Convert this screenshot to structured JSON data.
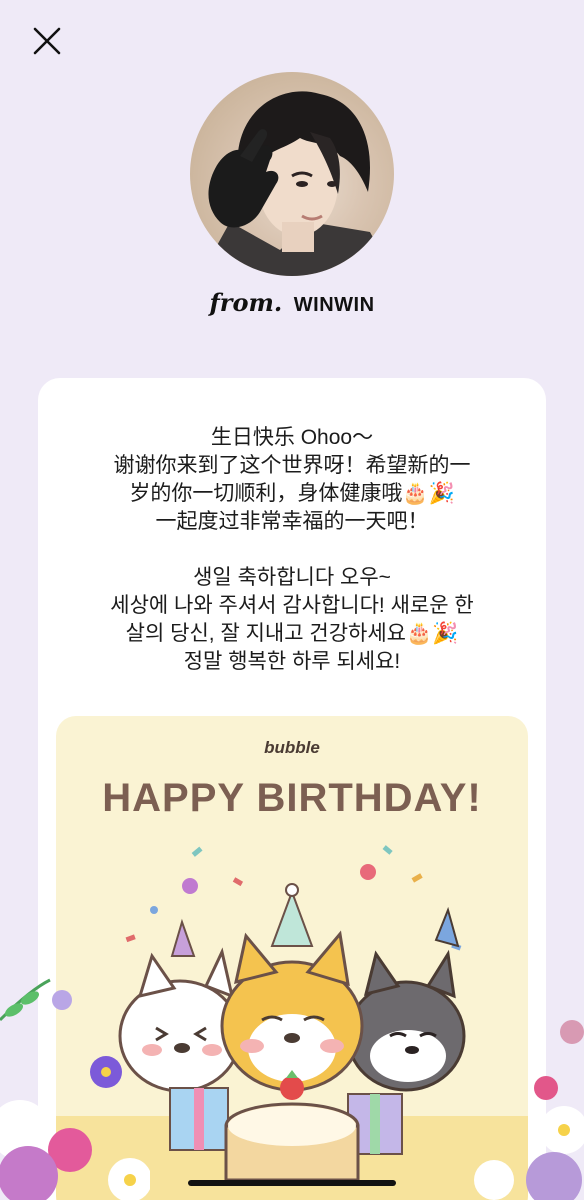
{
  "header": {
    "close_icon": "close-icon"
  },
  "profile": {
    "from_prefix": "from.",
    "name": "WINWIN"
  },
  "message": {
    "zh_lines": [
      "生日快乐 Ohoo～",
      "谢谢你来到了这个世界呀！希望新的一",
      "岁的你一切顺利，身体健康哦🎂🎉",
      "一起度过非常幸福的一天吧！"
    ],
    "ko_lines": [
      "생일 축하합니다 오우~",
      "세상에 나와 주셔서 감사합니다! 새로운 한",
      "살의 당신, 잘 지내고 건강하세요🎂🎉",
      "정말 행복한 하루 되세요!"
    ]
  },
  "birthday_card": {
    "logo": "bubble",
    "title": "HAPPY BIRTHDAY!",
    "background_color": "#faf3d3",
    "title_color": "#7c5f52"
  },
  "colors": {
    "page_background": "#efeaf7",
    "card_background": "#ffffff"
  }
}
